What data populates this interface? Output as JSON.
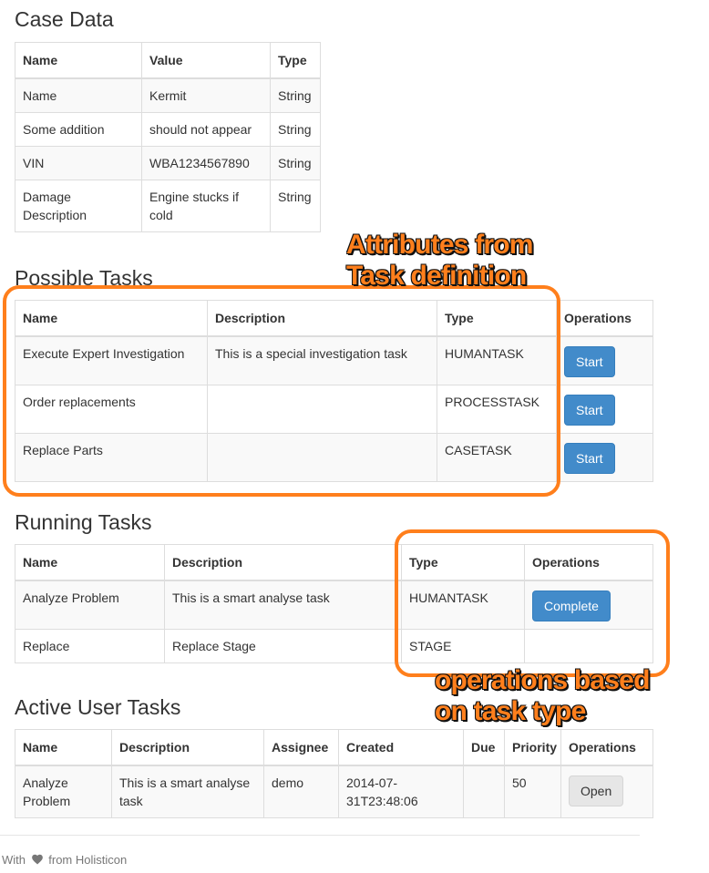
{
  "case_data": {
    "title": "Case Data",
    "headers": [
      "Name",
      "Value",
      "Type"
    ],
    "rows": [
      [
        "Name",
        "Kermit",
        "String"
      ],
      [
        "Some addition",
        "should not appear",
        "String"
      ],
      [
        "VIN",
        "WBA1234567890",
        "String"
      ],
      [
        "Damage Description",
        "Engine stucks if cold",
        "String"
      ]
    ]
  },
  "possible_tasks": {
    "title": "Possible Tasks",
    "headers": [
      "Name",
      "Description",
      "Type",
      "Operations"
    ],
    "rows": [
      {
        "name": "Execute Expert Investigation",
        "description": "This is a special investigation task",
        "type": "HUMANTASK",
        "button": "Start"
      },
      {
        "name": "Order replacements",
        "description": "",
        "type": "PROCESSTASK",
        "button": "Start"
      },
      {
        "name": "Replace Parts",
        "description": "",
        "type": "CASETASK",
        "button": "Start"
      }
    ]
  },
  "running_tasks": {
    "title": "Running Tasks",
    "headers": [
      "Name",
      "Description",
      "Type",
      "Operations"
    ],
    "rows": [
      {
        "name": "Analyze Problem",
        "description": "This is a smart analyse task",
        "type": "HUMANTASK",
        "button": "Complete"
      },
      {
        "name": "Replace",
        "description": "Replace Stage",
        "type": "STAGE",
        "button": ""
      }
    ]
  },
  "active_user_tasks": {
    "title": "Active User Tasks",
    "headers": [
      "Name",
      "Description",
      "Assignee",
      "Created",
      "Due",
      "Priority",
      "Operations"
    ],
    "rows": [
      {
        "name": "Analyze Problem",
        "description": "This is a smart analyse task",
        "assignee": "demo",
        "created": "2014-07-31T23:48:06",
        "due": "",
        "priority": "50",
        "button": "Open"
      }
    ]
  },
  "annotations": {
    "attributes": [
      "Attributes from",
      "Task definition"
    ],
    "operations": [
      "operations based",
      "on task type"
    ],
    "color": "#ff7f1c"
  },
  "footer": {
    "prefix": "With",
    "suffix": "from Holisticon",
    "icon": "heart-icon"
  },
  "colors": {
    "primary_button": "#428bca",
    "default_button": "#e6e6e6",
    "stripe": "#f9f9f9",
    "border": "#dddddd"
  }
}
